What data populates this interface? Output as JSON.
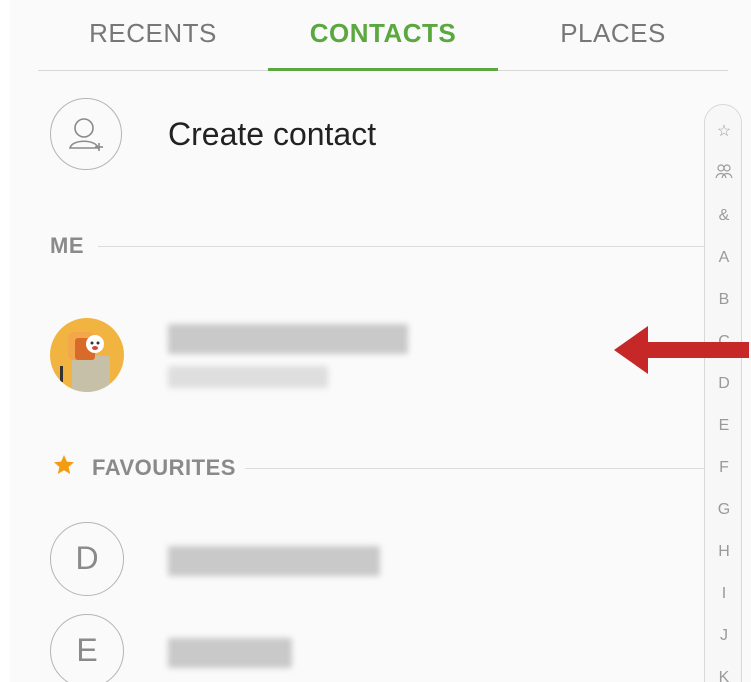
{
  "tabs": {
    "recents": "RECENTS",
    "contacts": "CONTACTS",
    "places": "PLACES",
    "active": "CONTACTS"
  },
  "create_contact": {
    "label": "Create contact",
    "icon": "add-person-icon"
  },
  "sections": {
    "me": "ME",
    "favourites": "FAVOURITES"
  },
  "contacts": {
    "me": {
      "avatar_icon": "cartoon-toast-avatar"
    },
    "favourites": [
      {
        "initial": "D"
      },
      {
        "initial": "E"
      }
    ]
  },
  "index_scroller": {
    "items": [
      "☆",
      "group-icon",
      "&",
      "A",
      "B",
      "C",
      "D",
      "E",
      "F",
      "G",
      "H",
      "I",
      "J",
      "K"
    ]
  },
  "annotation": {
    "icon": "red-arrow-left",
    "color": "#c62828"
  },
  "colors": {
    "accent": "#5aa83f",
    "star": "#f39c12",
    "arrow": "#c62828"
  }
}
